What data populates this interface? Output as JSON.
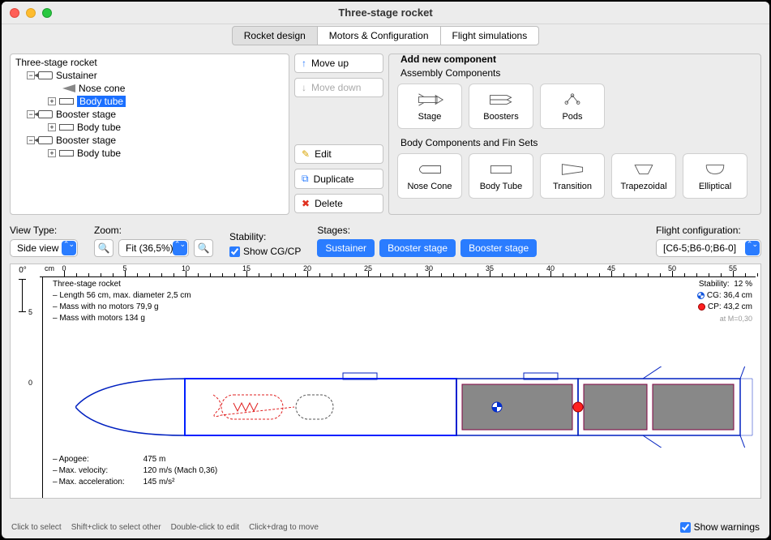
{
  "window": {
    "title": "Three-stage rocket"
  },
  "tabs": [
    "Rocket design",
    "Motors & Configuration",
    "Flight simulations"
  ],
  "active_tab": 0,
  "tree": {
    "root": "Three-stage rocket",
    "items": [
      {
        "label": "Sustainer",
        "type": "stage",
        "level": 1,
        "expander": "-"
      },
      {
        "label": "Nose cone",
        "type": "nose",
        "level": 2
      },
      {
        "label": "Body tube",
        "type": "body",
        "level": 2,
        "expander": "+",
        "selected": true
      },
      {
        "label": "Booster stage",
        "type": "stage",
        "level": 1,
        "expander": "-"
      },
      {
        "label": "Body tube",
        "type": "body",
        "level": 2,
        "expander": "+"
      },
      {
        "label": "Booster stage",
        "type": "stage",
        "level": 1,
        "expander": "-"
      },
      {
        "label": "Body tube",
        "type": "body",
        "level": 2,
        "expander": "+"
      }
    ]
  },
  "move_buttons": {
    "up": "Move up",
    "down": "Move down",
    "edit": "Edit",
    "duplicate": "Duplicate",
    "delete": "Delete"
  },
  "add_panel": {
    "title": "Add new component",
    "section1": "Assembly Components",
    "assembly": [
      "Stage",
      "Boosters",
      "Pods"
    ],
    "section2": "Body Components and Fin Sets",
    "body": [
      "Nose Cone",
      "Body Tube",
      "Transition",
      "Trapezoidal",
      "Elliptical"
    ]
  },
  "view": {
    "view_type_label": "View Type:",
    "view_type": "Side view",
    "zoom_label": "Zoom:",
    "zoom": "Fit (36,5%)",
    "stability_label": "Stability:",
    "show_cgcp": "Show CG/CP",
    "stages_label": "Stages:",
    "stage_pills": [
      "Sustainer",
      "Booster stage",
      "Booster stage"
    ],
    "config_label": "Flight configuration:",
    "config": "[C6-5;B6-0;B6-0]"
  },
  "rocket_info": {
    "name": "Three-stage rocket",
    "dimensions": "Length 56 cm, max. diameter 2,5 cm",
    "mass_empty": "Mass with no motors 79,9 g",
    "mass_loaded": "Mass with motors 134 g"
  },
  "stability": {
    "label": "Stability:",
    "value": "12 %",
    "cg_label": "CG:",
    "cg": "36,4 cm",
    "cp_label": "CP:",
    "cp": "43,2 cm",
    "mach": "at M=0,30"
  },
  "flight": {
    "apogee_label": "Apogee:",
    "apogee": "475 m",
    "vel_label": "Max. velocity:",
    "vel": "120 m/s  (Mach 0,36)",
    "accel_label": "Max. acceleration:",
    "accel": "145 m/s²"
  },
  "ruler": {
    "unit": "cm",
    "marks": [
      0,
      5,
      10,
      15,
      20,
      25,
      30,
      35,
      40,
      45,
      50,
      55
    ],
    "deg": "0°",
    "y_marks": [
      5,
      0
    ]
  },
  "footer": {
    "tips": [
      "Click to select",
      "Shift+click to select other",
      "Double-click to edit",
      "Click+drag to move"
    ],
    "show_warnings": "Show warnings"
  }
}
